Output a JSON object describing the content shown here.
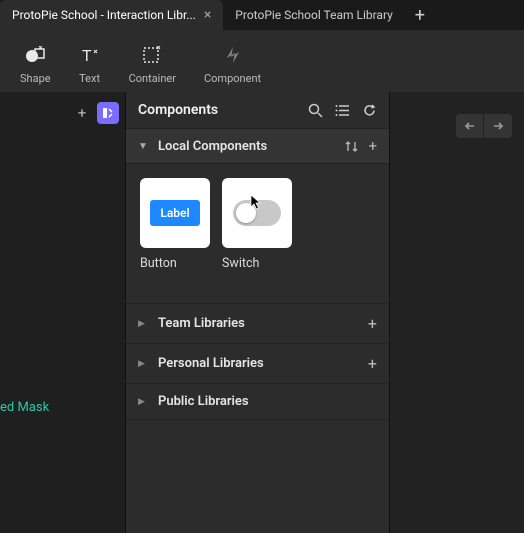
{
  "tabs": {
    "active": "ProtoPie School - Interaction Libr...",
    "inactive": "ProtoPie School Team Library"
  },
  "toolbar": {
    "shape": "Shape",
    "text": "Text",
    "container": "Container",
    "component": "Component"
  },
  "panel": {
    "title": "Components",
    "local_section": "Local Components",
    "items": [
      {
        "name": "Button",
        "chip": "Label"
      },
      {
        "name": "Switch"
      }
    ],
    "libs": {
      "team": "Team Libraries",
      "personal": "Personal Libraries",
      "public": "Public Libraries"
    }
  },
  "left": {
    "mask_text": "ed Mask"
  }
}
